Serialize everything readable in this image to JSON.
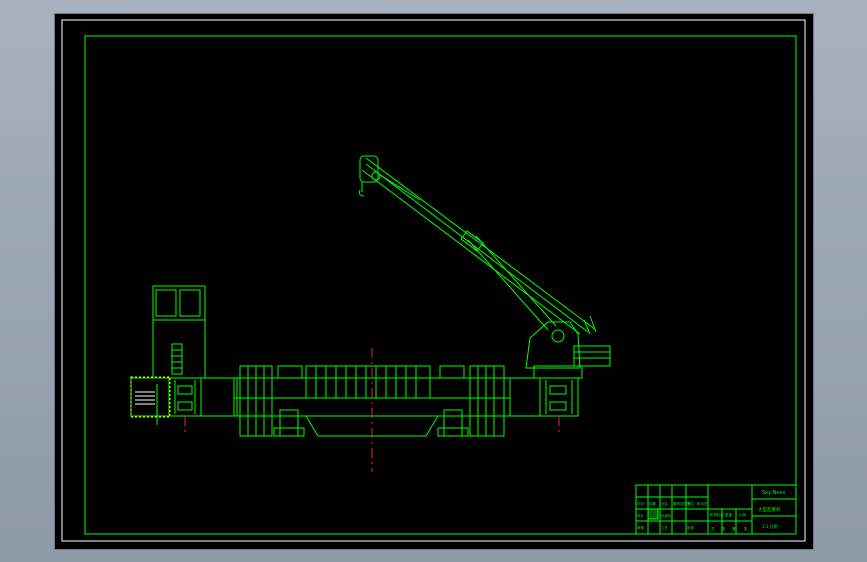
{
  "title_block": {
    "drawing_name": "Sxy Nxxx",
    "part_name": "大型起重机",
    "scale_note": "1:1  比例",
    "revision_headers": [
      "标记",
      "处数",
      "分区",
      "更改文件号",
      "签名",
      "年月日"
    ],
    "role_labels": [
      "设计",
      "标准化",
      "审核",
      "工艺",
      "批准"
    ],
    "stage_labels": [
      "阶段标记",
      "重量",
      "比例"
    ],
    "footer_labels": [
      "共",
      "张",
      "第",
      "张"
    ]
  },
  "colors": {
    "line": "#00ff00",
    "center_line": "#ff2020",
    "highlight": "#ffffff",
    "selection": "#ffff00",
    "canvas": "#000000"
  }
}
